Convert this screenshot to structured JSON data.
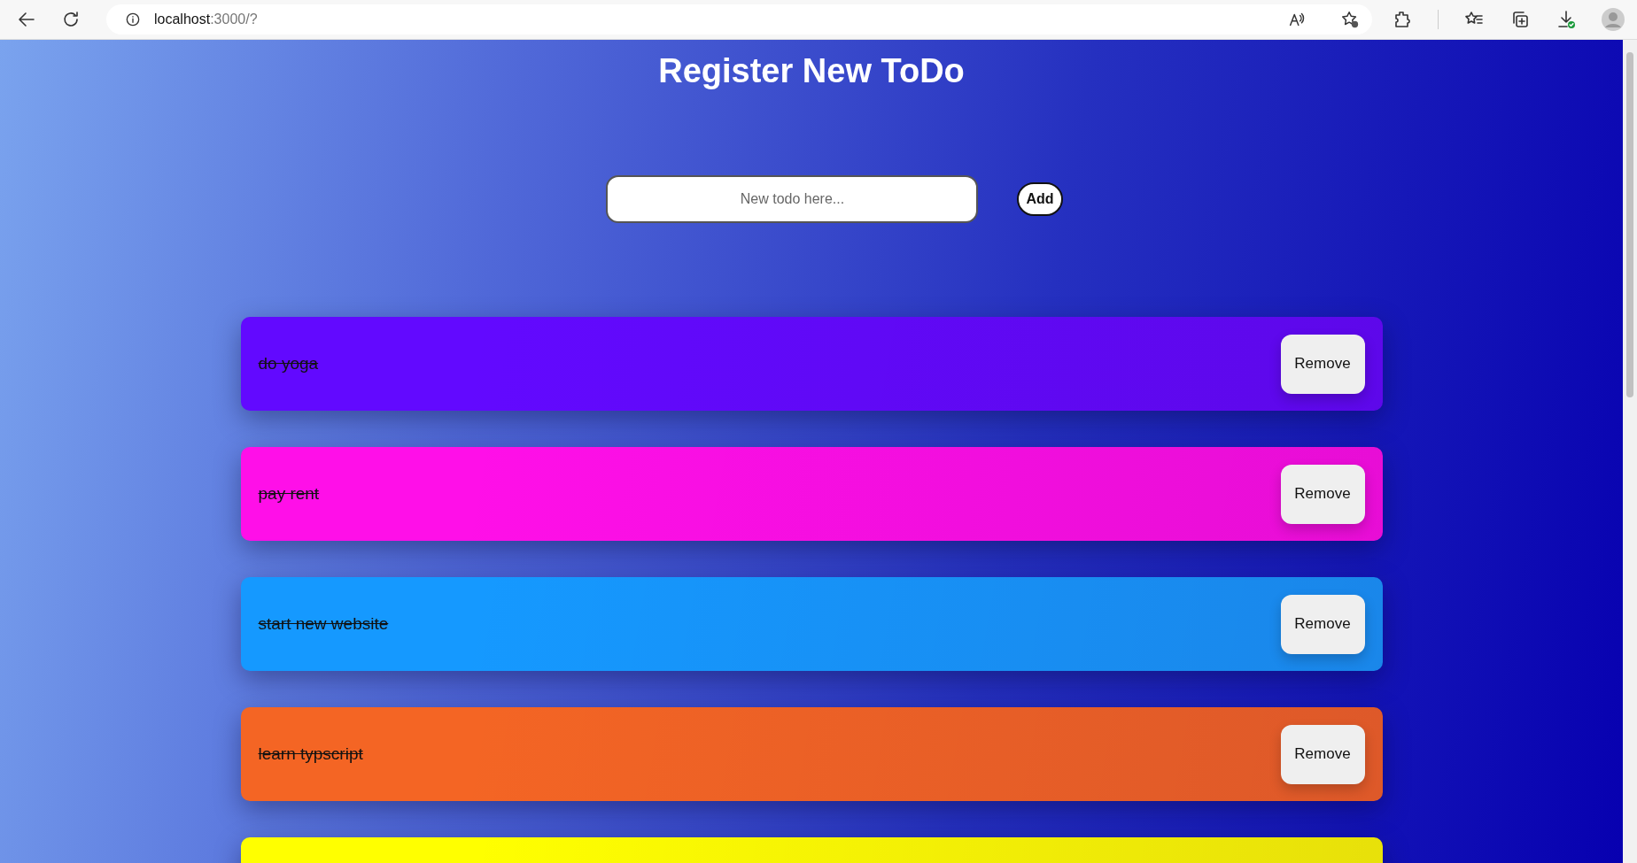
{
  "browser": {
    "address_host": "localhost",
    "address_rest": ":3000/?"
  },
  "heading": "Register New ToDo",
  "new_todo": {
    "placeholder": "New todo here...",
    "button": "Add"
  },
  "todos": [
    {
      "text": "do yoga",
      "done": true,
      "color": "#6209ff",
      "button": "Remove"
    },
    {
      "text": "pay rent",
      "done": true,
      "color": "#ff0fe8",
      "button": "Remove"
    },
    {
      "text": "start new website",
      "done": true,
      "color": "#1599ff",
      "button": "Remove"
    },
    {
      "text": "learn typscript",
      "done": true,
      "color": "#f46524",
      "button": "Remove"
    },
    {
      "color": "#ffff00"
    }
  ]
}
